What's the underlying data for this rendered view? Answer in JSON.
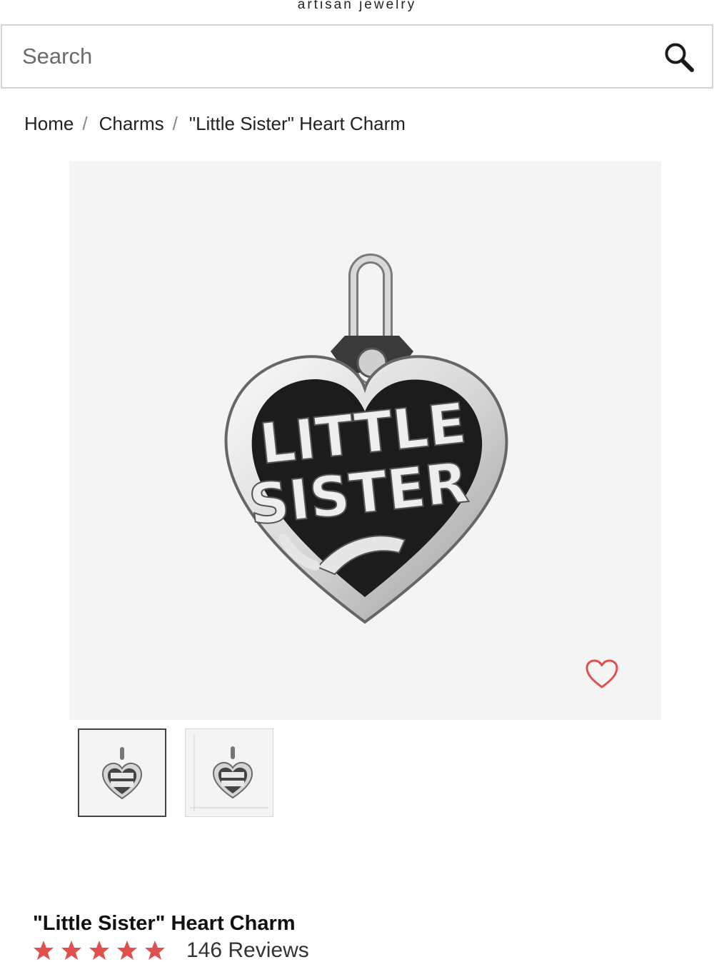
{
  "header": {
    "tagline": "artisan jewelry"
  },
  "search": {
    "placeholder": "Search",
    "value": "",
    "icon": "search-icon"
  },
  "breadcrumb": [
    {
      "label": "Home"
    },
    {
      "label": "Charms"
    },
    {
      "label": "\"Little Sister\" Heart Charm"
    }
  ],
  "product": {
    "title": "\"Little Sister\" Heart Charm",
    "image_text_line1": "LITTLE",
    "image_text_line2": "SISTER",
    "rating_stars": 5,
    "review_count_label": "146 Reviews",
    "wishlist_icon": "heart-outline-icon",
    "thumbnails": [
      {
        "name": "front-view",
        "active": true
      },
      {
        "name": "size-view",
        "active": false
      }
    ]
  },
  "colors": {
    "accent": "#e0504c",
    "image_bg": "#f4f4f4",
    "silver": "#cfcfcf"
  }
}
